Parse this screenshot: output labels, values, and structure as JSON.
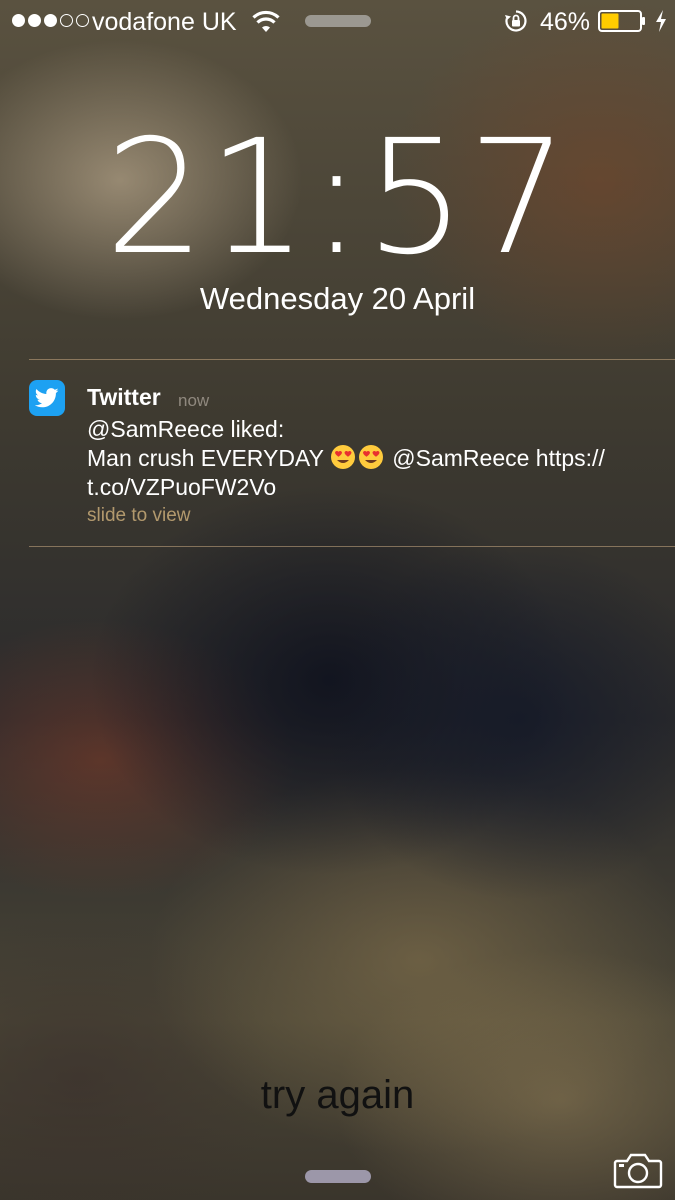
{
  "status_bar": {
    "signal_bars": 5,
    "signal_filled": 3,
    "carrier": "vodafone UK",
    "battery_percent": "46%",
    "battery_level": 0.46,
    "battery_color": "#ffcc00"
  },
  "lock_screen": {
    "time": "21:57",
    "date": "Wednesday 20 April"
  },
  "notification": {
    "app_name": "Twitter",
    "time": "now",
    "line1": "@SamReece liked:",
    "line2_prefix": "Man crush EVERYDAY",
    "line2_emoji": [
      "heart-eyes-emoji",
      "heart-eyes-emoji"
    ],
    "line2_suffix": " @SamReece https://",
    "line3": "t.co/VZPuoFW2Vo",
    "action": "slide to view",
    "icon_color": "#1da1f2"
  },
  "overlay": {
    "caption": "try again"
  },
  "icons": {
    "wifi": "wifi-icon",
    "rotation_lock": "rotation-lock-icon",
    "battery": "battery-icon",
    "charging": "charging-bolt-icon",
    "camera": "camera-icon",
    "app": "twitter-bird-icon"
  }
}
